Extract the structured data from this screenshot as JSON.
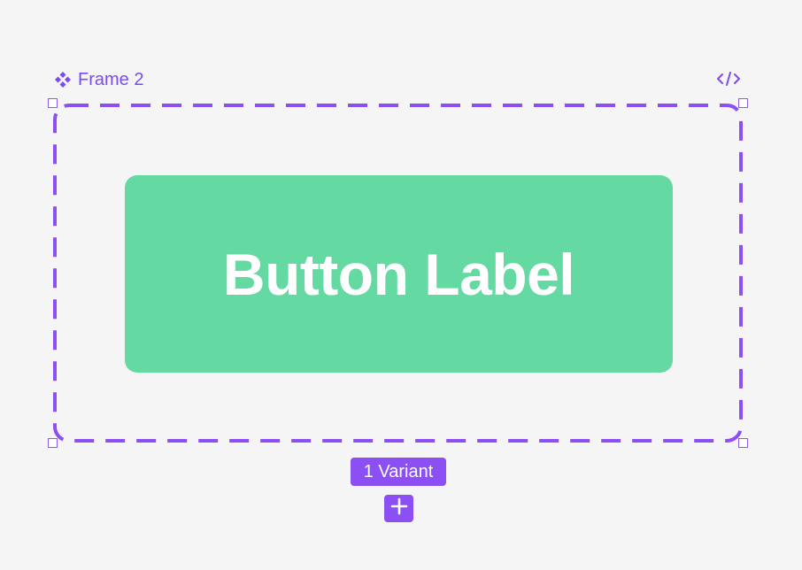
{
  "frame": {
    "name": "Frame 2",
    "component_icon": "component-set-icon",
    "code_icon": "code-icon"
  },
  "button": {
    "label": "Button Label"
  },
  "variants": {
    "count_label": "1 Variant",
    "add_icon": "plus-icon"
  },
  "colors": {
    "accent": "#8c4ff4",
    "button_fill": "#64d9a2",
    "canvas": "#f5f5f5"
  }
}
